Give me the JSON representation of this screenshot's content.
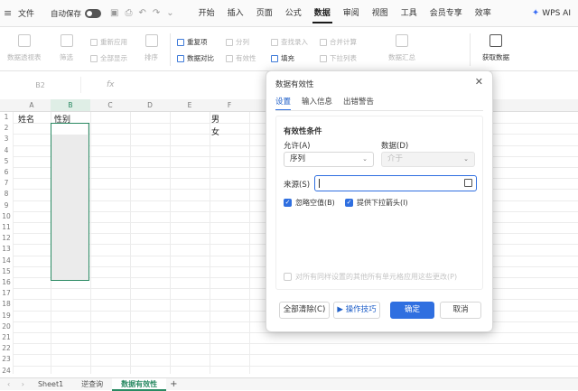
{
  "menubar": {
    "file": "文件",
    "autosave": "自动保存",
    "tabs": [
      "开始",
      "插入",
      "页面",
      "公式",
      "数据",
      "审阅",
      "视图",
      "工具",
      "会员专享",
      "效率"
    ],
    "active_tab": "数据",
    "ai_label": "WPS AI"
  },
  "ribbon": {
    "pivot": "数据透视表",
    "filter": "筛选",
    "reapply": "重新应用",
    "reset": "全部显示",
    "sort": "排序",
    "dedup": "重复项",
    "compare": "数据对比",
    "split": "分列",
    "validity": "有效性",
    "fill": "填充",
    "lookup": "查找录入",
    "merge": "合并计算",
    "dropdown": "下拉列表",
    "consolidate": "数据汇总",
    "getdata": "获取数据"
  },
  "formula": {
    "cell_ref": "B2",
    "fx": "fx"
  },
  "grid": {
    "columns": [
      "A",
      "B",
      "C",
      "D",
      "E",
      "F"
    ],
    "rows": [
      "1",
      "2",
      "3",
      "4",
      "5",
      "6",
      "7",
      "8",
      "9",
      "10",
      "11",
      "12",
      "13",
      "14",
      "15",
      "16",
      "17",
      "18",
      "19",
      "20",
      "21",
      "22",
      "23",
      "24"
    ],
    "a1": "姓名",
    "b1": "性别",
    "f1": "男",
    "f2": "女"
  },
  "sheets": {
    "tabs": [
      "Sheet1",
      "逆查询",
      "数据有效性"
    ],
    "active": "数据有效性",
    "add": "+"
  },
  "dialog": {
    "title": "数据有效性",
    "close": "✕",
    "tabs": [
      "设置",
      "输入信息",
      "出错警告"
    ],
    "active_tab": "设置",
    "section": "有效性条件",
    "allow_label": "允许(A)",
    "allow_value": "序列",
    "data_label": "数据(D)",
    "data_value": "介于",
    "source_label": "来源(S)",
    "source_value": "",
    "ignore_blank": "忽略空值(B)",
    "ignore_blank_checked": true,
    "dropdown_arrow": "提供下拉箭头(I)",
    "dropdown_arrow_checked": true,
    "apply_all": "对所有同样设置的其他所有单元格应用这些更改(P)",
    "apply_all_checked": false,
    "clear_all": "全部清除(C)",
    "tips": "操作技巧",
    "ok": "确定",
    "cancel": "取消"
  },
  "colors": {
    "accent": "#2f6fe0",
    "selection": "#2a8a63"
  }
}
